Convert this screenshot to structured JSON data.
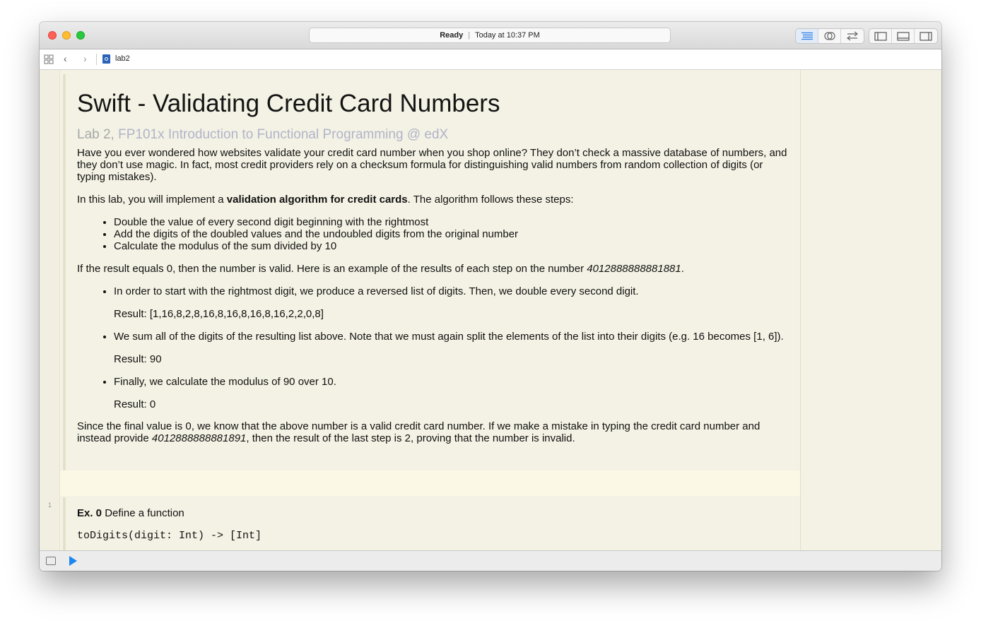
{
  "window": {
    "status_ready": "Ready",
    "status_time": "Today at 10:37 PM"
  },
  "jumpbar": {
    "file_name": "lab2"
  },
  "doc": {
    "title": "Swift - Validating Credit Card Numbers",
    "subtitle_prefix": "Lab 2, ",
    "subtitle_course": "FP101x Introduction to Functional Programming @ edX",
    "intro": "Have you ever wondered how websites validate your credit card number when you shop online? They don’t check a massive database of numbers, and they don’t use magic. In fact, most credit providers rely on a checksum formula for distinguishing valid numbers from random collection of digits (or typing mistakes).",
    "lab_pre": "In this lab, you will implement a ",
    "lab_bold": "validation algorithm for credit cards",
    "lab_post": ". The algorithm follows these steps:",
    "algorithm_steps": [
      "Double the value of every second digit beginning with the rightmost",
      "Add the digits of the doubled values and the undoubled digits from the original number",
      "Calculate the modulus of the sum divided by 10"
    ],
    "example_pre": "If the result equals 0, then the number is valid. Here is an example of the results of each step on the number ",
    "example_number": "4012888888881881",
    "example_post": ".",
    "example_steps": [
      {
        "text": "In order to start with the rightmost digit, we produce a reversed list of digits. Then, we double every second digit.",
        "result": "Result: [1,16,8,2,8,16,8,16,8,16,8,16,2,2,0,8]"
      },
      {
        "text": "We sum all of the digits of the resulting list above. Note that we must again split the elements of the list into their digits (e.g. 16 becomes [1, 6]).",
        "result": "Result: 90"
      },
      {
        "text": "Finally, we calculate the modulus of 90 over 10.",
        "result": "Result: 0"
      }
    ],
    "conclusion_pre": "Since the final value is 0, we know that the above number is a valid credit card number. If we make a mistake in typing the credit card number and instead provide ",
    "conclusion_number": "4012888888881891",
    "conclusion_post": ", then the result of the last step is 2, proving that the number is invalid."
  },
  "gutter": {
    "line_number": "1"
  },
  "exercise": {
    "label": "Ex. 0",
    "text": " Define a function",
    "signature": "toDigits(digit: Int) -> [Int]"
  },
  "colors": {
    "accent_blue": "#1d86f0",
    "page_background": "#f4f2e4",
    "subtitle_gray": "#a7a9a9"
  }
}
